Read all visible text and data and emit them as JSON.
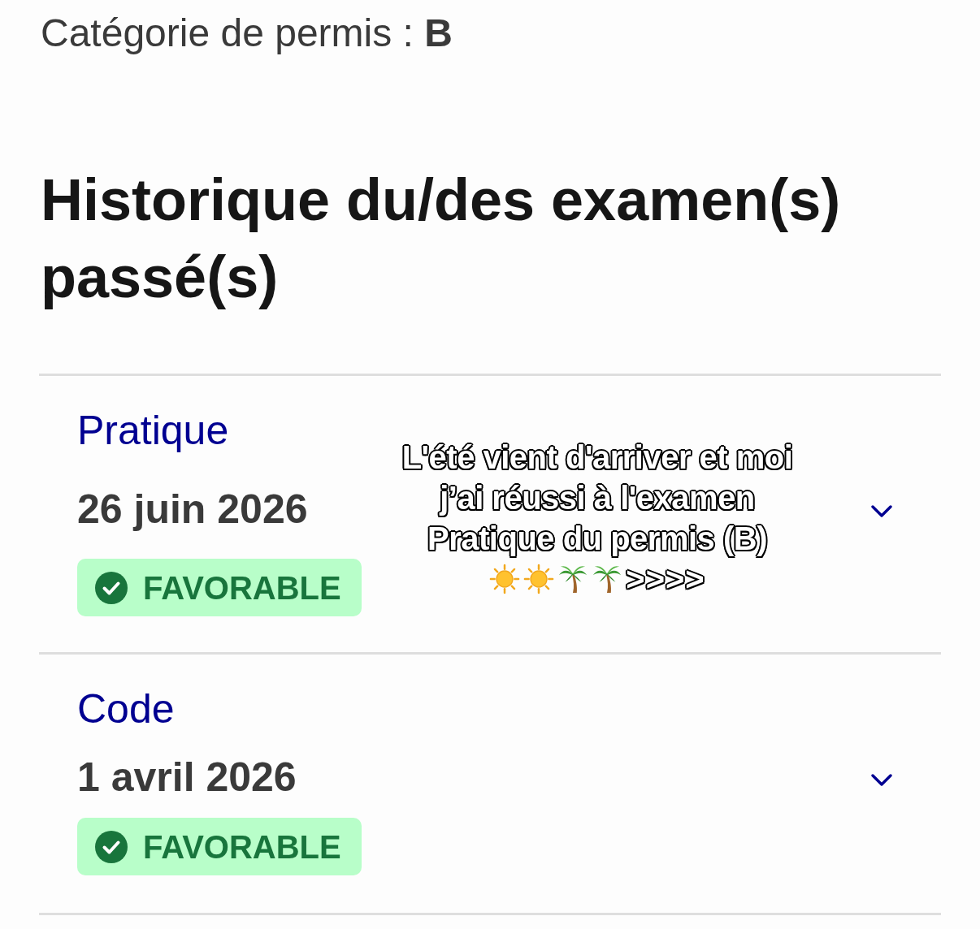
{
  "license_category": "Catégorie de permis : **B**",
  "history": {
    "title": "Historique du/des examen(s) passé(s)",
    "exams": [
      {
        "type": "Pratique",
        "date": "26 juin 2026",
        "result": {
          "label": "FAVORABLE",
          "kind": "success"
        },
        "expanded": false
      },
      {
        "type": "Code",
        "date": "1 avril 2026",
        "result": {
          "label": "FAVORABLE",
          "kind": "success"
        },
        "expanded": false
      }
    ]
  },
  "caption": {
    "lines": [
      "L'été vient d'arriver et moi",
      "j’ai réussi à l'examen",
      "Pratique du permis (B)"
    ],
    "ending": ">>>>"
  }
}
